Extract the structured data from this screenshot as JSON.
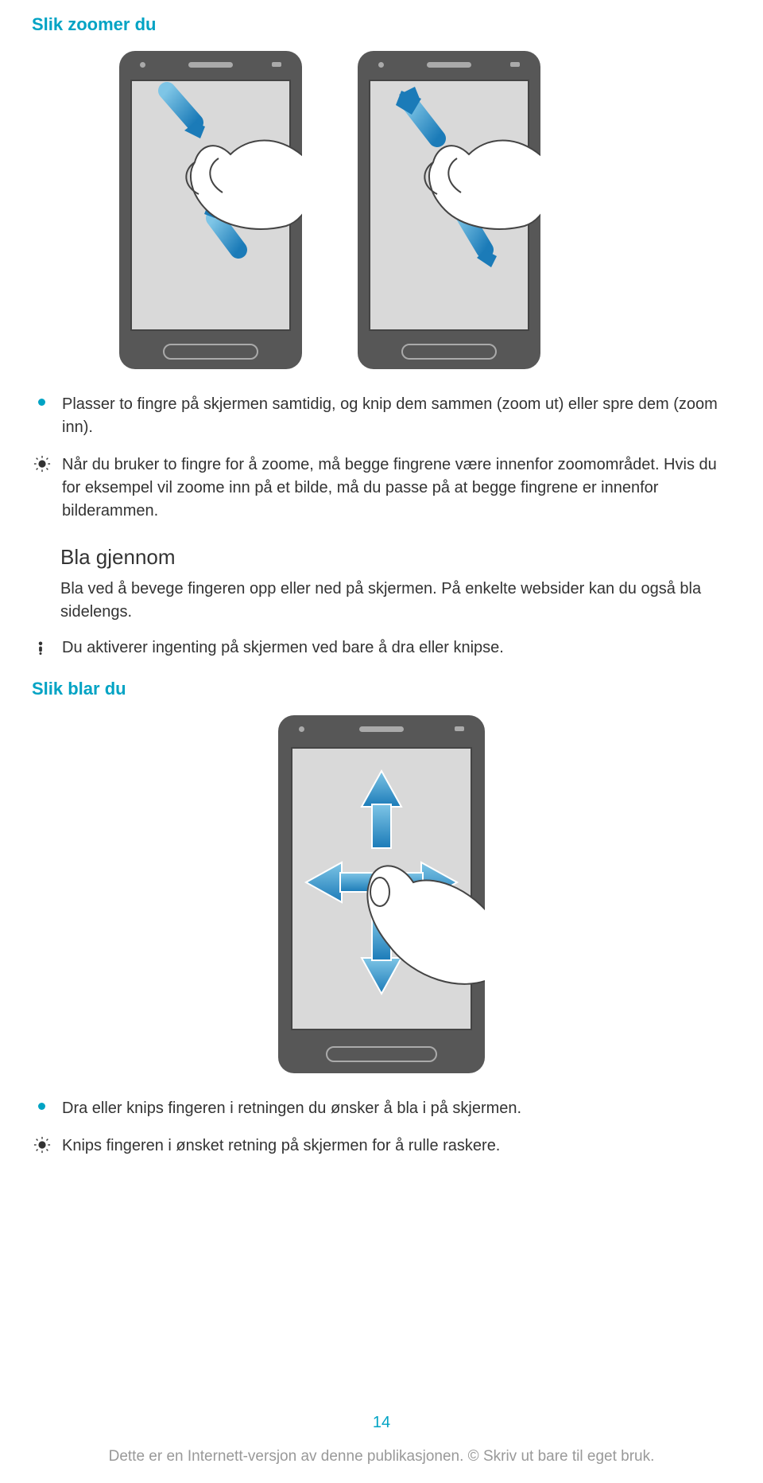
{
  "headings": {
    "zoom": "Slik zoomer du",
    "scrollHeadingBlack": "Bla gjennom",
    "scrollTeal": "Slik blar du"
  },
  "zoom": {
    "bullet": "Plasser to fingre på skjermen samtidig, og knip dem sammen (zoom ut) eller spre dem (zoom inn).",
    "tip": "Når du bruker to fingre for å zoome, må begge fingrene være innenfor zoomområdet. Hvis du for eksempel vil zoome inn på et bilde, må du passe på at begge fingrene er innenfor bilderammen."
  },
  "scroll": {
    "body": "Bla ved å bevege fingeren opp eller ned på skjermen. På enkelte websider kan du også bla sidelengs.",
    "warn": "Du aktiverer ingenting på skjermen ved bare å dra eller knipse.",
    "bullet": "Dra eller knips fingeren i retningen du ønsker å bla i på skjermen.",
    "tip": "Knips fingeren i ønsket retning på skjermen for å rulle raskere."
  },
  "page": "14",
  "footer": "Dette er en Internett-versjon av denne publikasjonen. © Skriv ut bare til eget bruk."
}
